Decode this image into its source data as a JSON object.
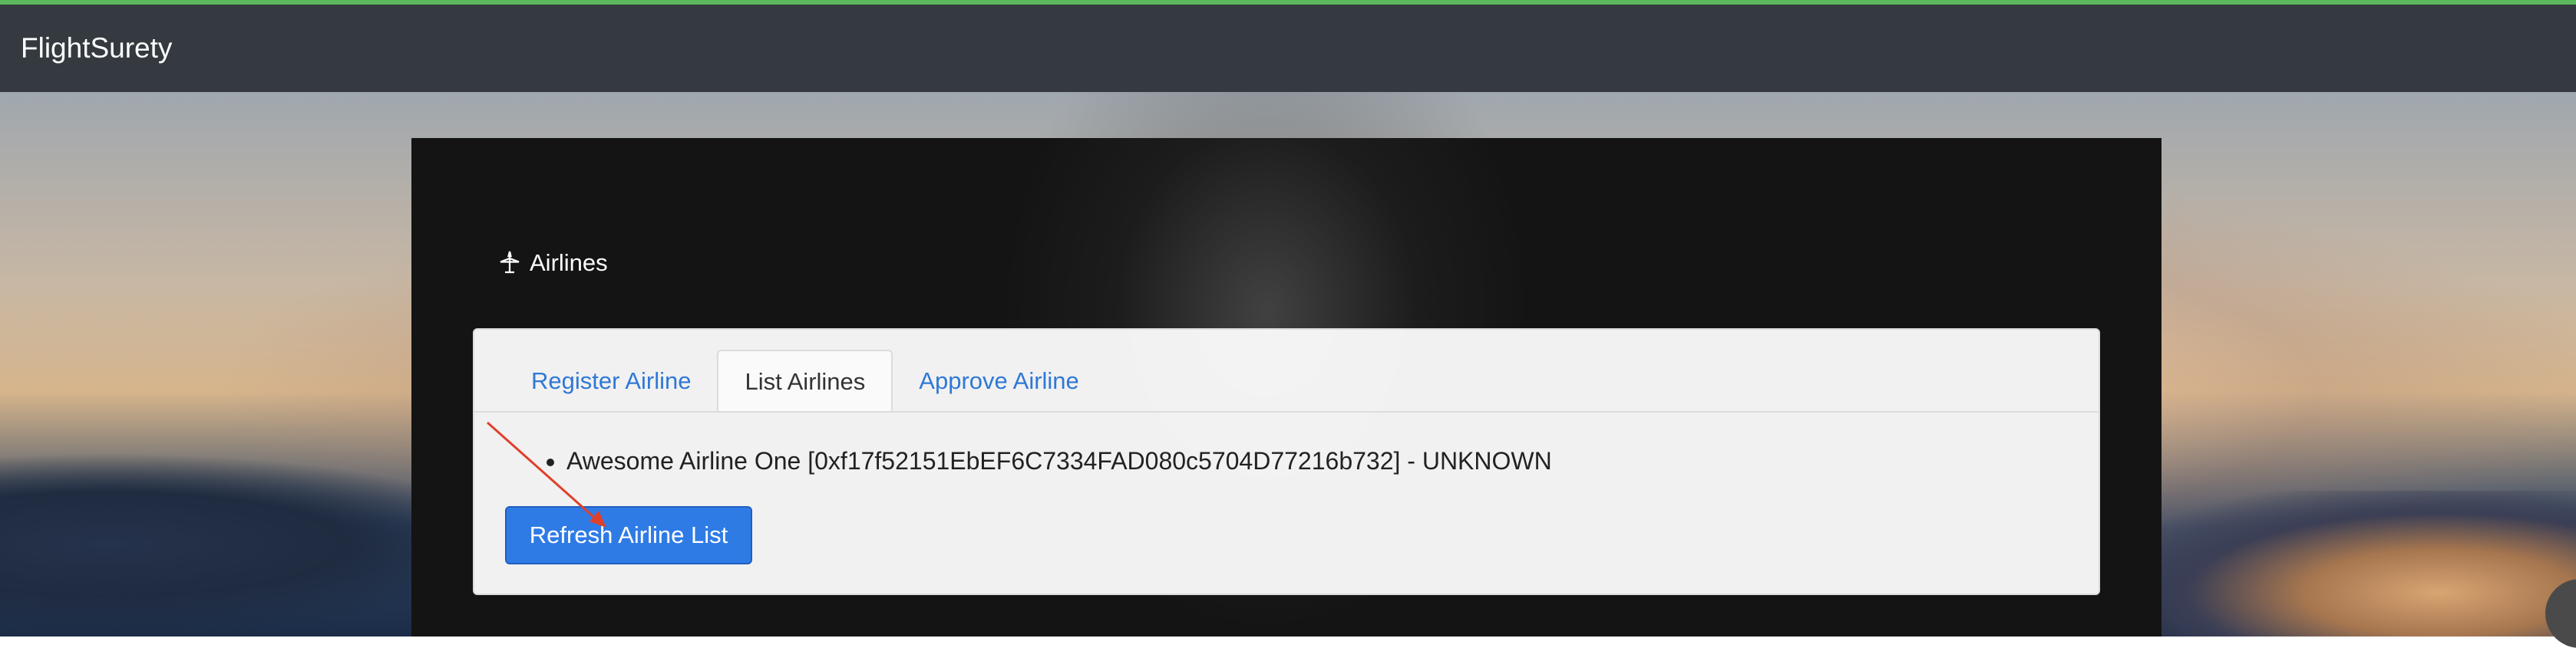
{
  "navbar": {
    "brand": "FlightSurety"
  },
  "section": {
    "title": "Airlines",
    "icon": "airplane-icon"
  },
  "tabs": [
    {
      "label": "Register Airline",
      "active": false
    },
    {
      "label": "List Airlines",
      "active": true
    },
    {
      "label": "Approve Airline",
      "active": false
    }
  ],
  "airlines": [
    {
      "text": "Awesome Airline One [0xf17f52151EbEF6C7334FAD080c5704D77216b732] - UNKNOWN"
    }
  ],
  "refresh_button": {
    "label": "Refresh Airline List"
  },
  "colors": {
    "accent": "#2f7be6",
    "tab_link": "#2f78d6",
    "navbar": "#343a40",
    "top_line": "#5cb85c",
    "annotation_arrow": "#e0402a"
  }
}
